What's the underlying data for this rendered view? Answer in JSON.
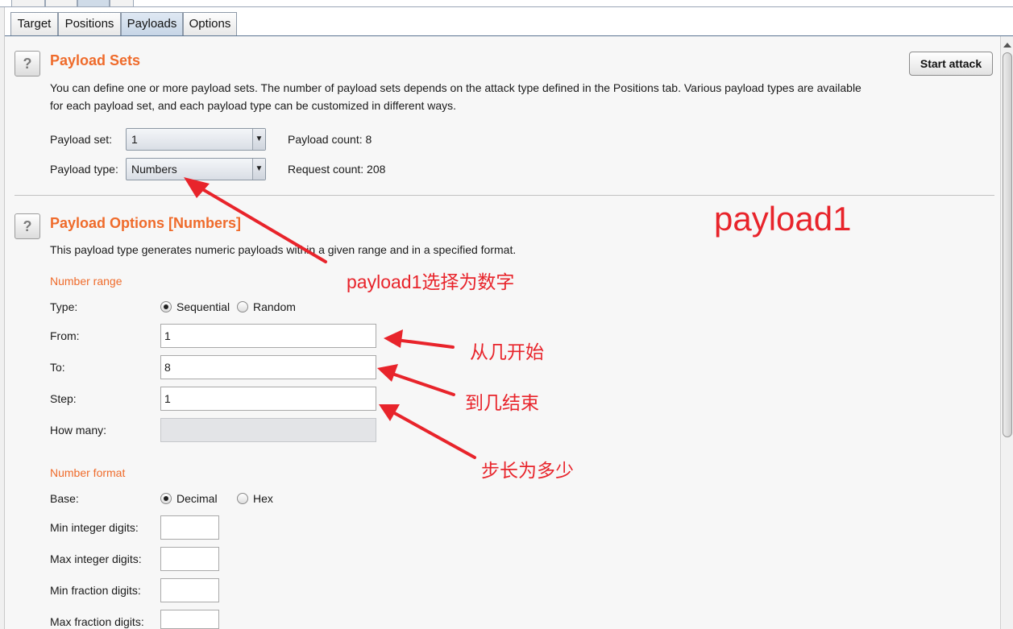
{
  "tabs": [
    {
      "label": "Target"
    },
    {
      "label": "Positions"
    },
    {
      "label": "Payloads"
    },
    {
      "label": "Options"
    }
  ],
  "payload_sets": {
    "title": "Payload Sets",
    "description_line1": "You can define one or more payload sets. The number of payload sets depends on the attack type defined in the Positions tab. Various payload types are available",
    "description_line2": "for each payload set, and each payload type can be customized in different ways.",
    "start_attack_label": "Start attack",
    "payload_set_label": "Payload set:",
    "payload_set_value": "1",
    "payload_type_label": "Payload type:",
    "payload_type_value": "Numbers",
    "payload_count": "Payload count:  8",
    "request_count": "Request count:  208"
  },
  "payload_options": {
    "title": "Payload Options [Numbers]",
    "description": "This payload type generates numeric payloads within a given range and in a specified format.",
    "number_range_title": "Number range",
    "type_label": "Type:",
    "type_sequential": "Sequential",
    "type_random": "Random",
    "type_selected": "Sequential",
    "from_label": "From:",
    "from_value": "1",
    "to_label": "To:",
    "to_value": "8",
    "step_label": "Step:",
    "step_value": "1",
    "how_many_label": "How many:",
    "how_many_value": "",
    "number_format_title": "Number format",
    "base_label": "Base:",
    "base_decimal": "Decimal",
    "base_hex": "Hex",
    "base_selected": "Decimal",
    "min_int_label": "Min integer digits:",
    "max_int_label": "Max integer digits:",
    "min_frac_label": "Min fraction digits:",
    "max_frac_label": "Max fraction digits:"
  },
  "annotations": {
    "big": "payload1",
    "payload_type_note": "payload1选择为数字",
    "from_note": "从几开始",
    "to_note": "到几结束",
    "step_note": "步长为多少"
  },
  "colors": {
    "section_title": "#ef6b2b",
    "annotation": "#e8242b",
    "active_tab": "#c6d5e6"
  },
  "icons": [
    "help-icon",
    "dropdown-arrow-icon",
    "scroll-up-icon"
  ]
}
